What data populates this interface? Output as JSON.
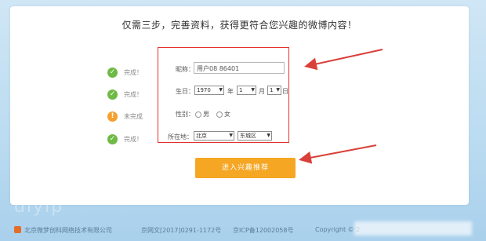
{
  "headline": "仅需三步，完善资料，获得更符合您兴趣的微博内容！",
  "steps": [
    {
      "status": "done",
      "icon": "✓",
      "label": "完成！"
    },
    {
      "status": "done",
      "icon": "✓",
      "label": "完成！"
    },
    {
      "status": "todo",
      "icon": "!",
      "label": "未完成"
    },
    {
      "status": "done",
      "icon": "✓",
      "label": "完成！"
    }
  ],
  "form": {
    "nickname_label": "昵称：",
    "nickname_value": "用户08  86401",
    "birthday_label": "生日：",
    "year_value": "1970",
    "year_unit": "年",
    "month_value": "1",
    "month_unit": "月",
    "day_value": "1",
    "day_unit": "日",
    "gender_label": "性别：",
    "gender_male": "男",
    "gender_female": "女",
    "location_label": "所在地：",
    "province_value": "北京",
    "district_value": "东城区"
  },
  "submit_label": "进入兴趣推荐",
  "watermark": "diyip",
  "footer": {
    "company": "北京微梦创科网络技术有限公司",
    "license": "京网文[2017]0291-1172号",
    "icp": "京ICP备12002058号",
    "copyright": "Copyright © 2"
  },
  "colors": {
    "accent_orange": "#f5a623",
    "highlight_red": "#e3322b",
    "done_green": "#6fba45",
    "todo_orange": "#f4a02e"
  }
}
